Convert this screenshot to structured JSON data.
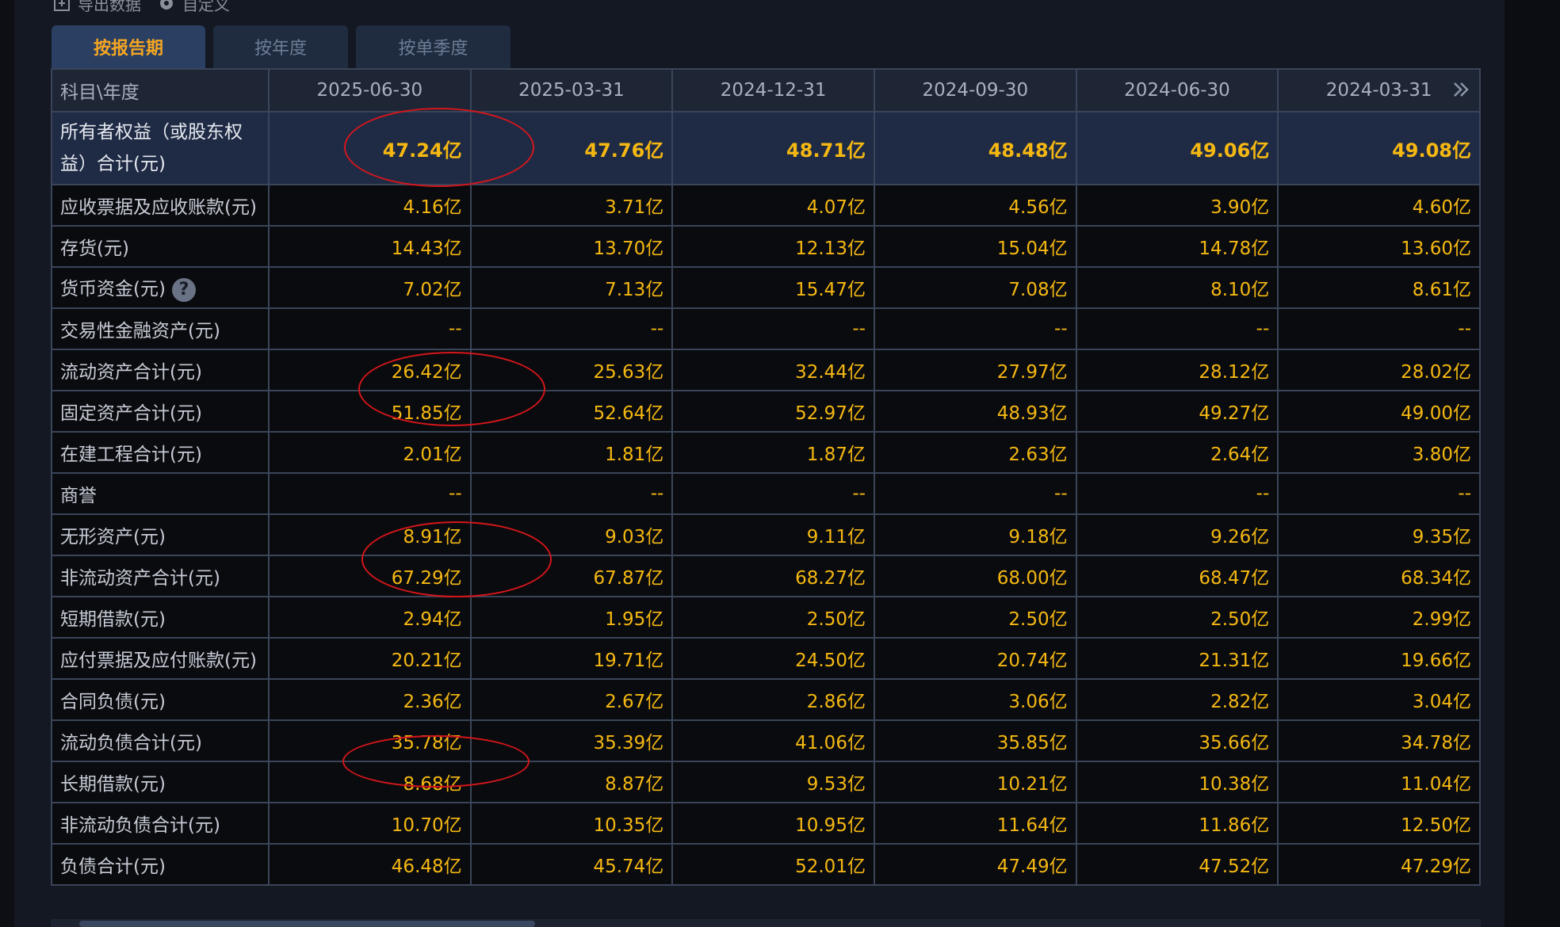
{
  "toolbar": {
    "export_label": "导出数据",
    "custom_label": "自定义"
  },
  "tabs": [
    {
      "label": "按报告期",
      "active": true
    },
    {
      "label": "按年度",
      "active": false
    },
    {
      "label": "按单季度",
      "active": false
    }
  ],
  "table": {
    "header_label": "科目\\年度",
    "periods": [
      "2025-06-30",
      "2025-03-31",
      "2024-12-31",
      "2024-09-30",
      "2024-06-30",
      "2024-03-31"
    ],
    "rows": [
      {
        "label": "所有者权益（或股东权益）合计(元)",
        "values": [
          "47.24亿",
          "47.76亿",
          "48.71亿",
          "48.48亿",
          "49.06亿",
          "49.08亿"
        ]
      },
      {
        "label": "应收票据及应收账款(元)",
        "values": [
          "4.16亿",
          "3.71亿",
          "4.07亿",
          "4.56亿",
          "3.90亿",
          "4.60亿"
        ]
      },
      {
        "label": "存货(元)",
        "values": [
          "14.43亿",
          "13.70亿",
          "12.13亿",
          "15.04亿",
          "14.78亿",
          "13.60亿"
        ]
      },
      {
        "label": "货币资金(元)",
        "values": [
          "7.02亿",
          "7.13亿",
          "15.47亿",
          "7.08亿",
          "8.10亿",
          "8.61亿"
        ]
      },
      {
        "label": "交易性金融资产(元)",
        "values": [
          "--",
          "--",
          "--",
          "--",
          "--",
          "--"
        ]
      },
      {
        "label": "流动资产合计(元)",
        "values": [
          "26.42亿",
          "25.63亿",
          "32.44亿",
          "27.97亿",
          "28.12亿",
          "28.02亿"
        ]
      },
      {
        "label": "固定资产合计(元)",
        "values": [
          "51.85亿",
          "52.64亿",
          "52.97亿",
          "48.93亿",
          "49.27亿",
          "49.00亿"
        ]
      },
      {
        "label": "在建工程合计(元)",
        "values": [
          "2.01亿",
          "1.81亿",
          "1.87亿",
          "2.63亿",
          "2.64亿",
          "3.80亿"
        ]
      },
      {
        "label": "商誉",
        "values": [
          "--",
          "--",
          "--",
          "--",
          "--",
          "--"
        ]
      },
      {
        "label": "无形资产(元)",
        "values": [
          "8.91亿",
          "9.03亿",
          "9.11亿",
          "9.18亿",
          "9.26亿",
          "9.35亿"
        ]
      },
      {
        "label": "非流动资产合计(元)",
        "values": [
          "67.29亿",
          "67.87亿",
          "68.27亿",
          "68.00亿",
          "68.47亿",
          "68.34亿"
        ]
      },
      {
        "label": "短期借款(元)",
        "values": [
          "2.94亿",
          "1.95亿",
          "2.50亿",
          "2.50亿",
          "2.50亿",
          "2.99亿"
        ]
      },
      {
        "label": "应付票据及应付账款(元)",
        "values": [
          "20.21亿",
          "19.71亿",
          "24.50亿",
          "20.74亿",
          "21.31亿",
          "19.66亿"
        ]
      },
      {
        "label": "合同负债(元)",
        "values": [
          "2.36亿",
          "2.67亿",
          "2.86亿",
          "3.06亿",
          "2.82亿",
          "3.04亿"
        ]
      },
      {
        "label": "流动负债合计(元)",
        "values": [
          "35.78亿",
          "35.39亿",
          "41.06亿",
          "35.85亿",
          "35.66亿",
          "34.78亿"
        ]
      },
      {
        "label": "长期借款(元)",
        "values": [
          "8.68亿",
          "8.87亿",
          "9.53亿",
          "10.21亿",
          "10.38亿",
          "11.04亿"
        ]
      },
      {
        "label": "非流动负债合计(元)",
        "values": [
          "10.70亿",
          "10.35亿",
          "10.95亿",
          "11.64亿",
          "11.86亿",
          "12.50亿"
        ]
      },
      {
        "label": "负债合计(元)",
        "values": [
          "46.48亿",
          "45.74亿",
          "52.01亿",
          "47.49亿",
          "47.52亿",
          "47.29亿"
        ]
      }
    ]
  },
  "help_glyph": "?",
  "colors": {
    "value": "#f5b812",
    "annotation": "#d4161c",
    "active_tab": "#f5a623"
  }
}
